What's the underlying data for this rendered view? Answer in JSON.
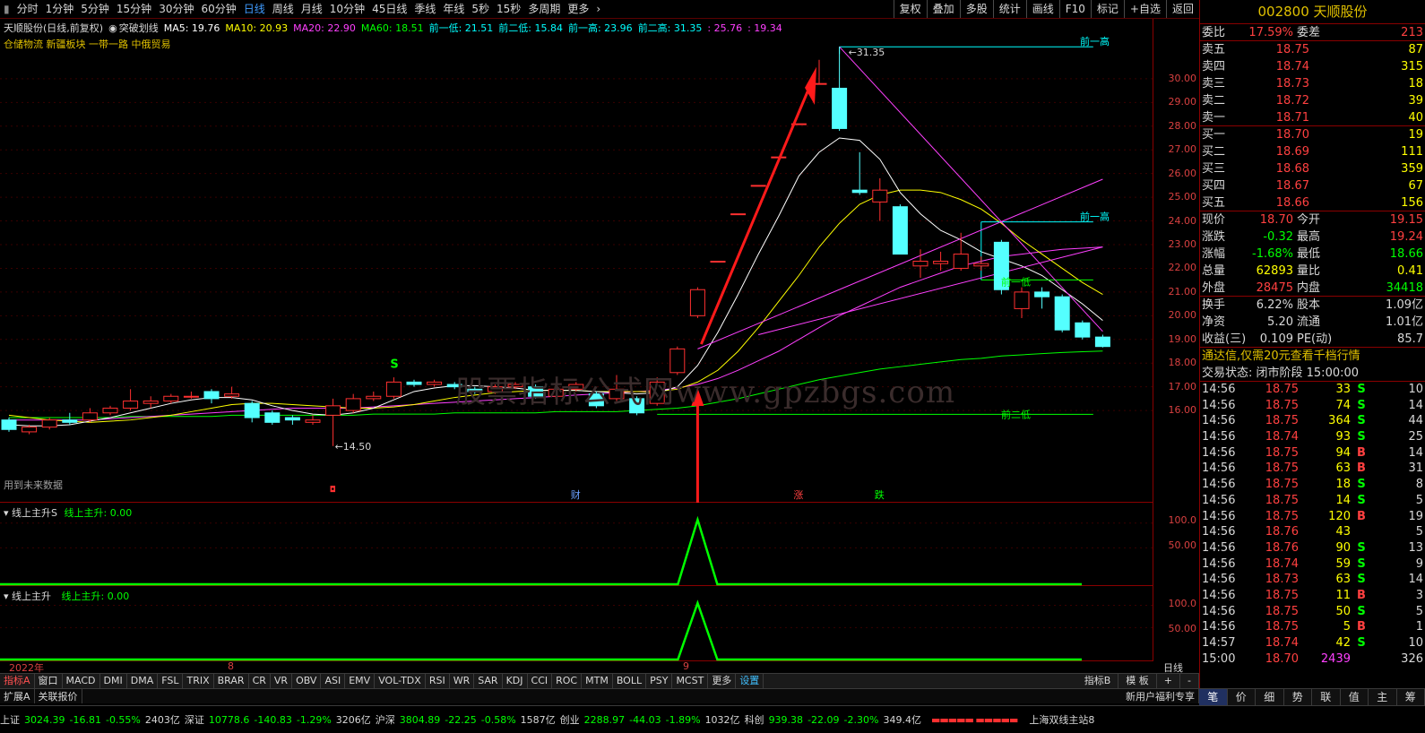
{
  "toolbar": {
    "periods": [
      "分时",
      "1分钟",
      "5分钟",
      "15分钟",
      "30分钟",
      "60分钟",
      "日线",
      "周线",
      "月线",
      "10分钟",
      "45日线",
      "季线",
      "年线",
      "5秒",
      "15秒",
      "多周期",
      "更多"
    ],
    "active_period": "日线",
    "right_buttons": [
      "复权",
      "叠加",
      "多股",
      "统计",
      "画线",
      "F10",
      "标记",
      "+自选",
      "返回"
    ]
  },
  "chart_title": {
    "name": "天顺股份(日线,前复权)",
    "indicator": "突破划线",
    "items": [
      {
        "label": "MA5: 19.76",
        "color": "#ffffff"
      },
      {
        "label": "MA10: 20.93",
        "color": "#ffff00"
      },
      {
        "label": "MA20: 22.90",
        "color": "#ff40ff"
      },
      {
        "label": "MA60: 18.51",
        "color": "#00ff00"
      },
      {
        "label": "前一低: 21.51",
        "color": "#00ffff"
      },
      {
        "label": "前二低: 15.84",
        "color": "#00ffff"
      },
      {
        "label": "前一高: 23.96",
        "color": "#00ffff"
      },
      {
        "label": "前二高: 31.35",
        "color": "#00ffff"
      },
      {
        "label": ": 25.76",
        "color": "#ff40ff"
      },
      {
        "label": ": 19.34",
        "color": "#ff40ff"
      }
    ],
    "sectors": "仓储物流 新疆板块 一带一路 中俄贸易",
    "future_warning": "用到未来数据"
  },
  "watermark": "股票指标公式网www.gpzbgs.com",
  "annotations": {
    "high_label": "31.35",
    "low_label": "14.50",
    "prev_high1": "前一高",
    "prev_high2": "前一高",
    "prev_low1": "前一低",
    "prev_low2": "前二低",
    "signal_s": "S",
    "markers": [
      "财",
      "涨",
      "跌"
    ]
  },
  "chart_data": {
    "type": "candlestick",
    "ylim": [
      14,
      32
    ],
    "y_ticks": [
      "30.00",
      "29.00",
      "28.00",
      "27.00",
      "26.00",
      "25.00",
      "24.00",
      "23.00",
      "22.00",
      "21.00",
      "20.00",
      "19.00",
      "18.00",
      "17.00",
      "16.00"
    ],
    "dates_axis": [
      "2022年",
      "8",
      "9"
    ],
    "candles": [
      {
        "o": 15.6,
        "c": 15.2,
        "h": 15.7,
        "l": 15.1
      },
      {
        "o": 15.1,
        "c": 15.3,
        "h": 15.4,
        "l": 15.0
      },
      {
        "o": 15.3,
        "c": 15.6,
        "h": 15.7,
        "l": 15.2
      },
      {
        "o": 15.6,
        "c": 15.5,
        "h": 15.9,
        "l": 15.4
      },
      {
        "o": 15.6,
        "c": 15.9,
        "h": 16.1,
        "l": 15.5
      },
      {
        "o": 15.9,
        "c": 16.1,
        "h": 16.2,
        "l": 15.8
      },
      {
        "o": 16.1,
        "c": 16.4,
        "h": 16.9,
        "l": 16.0
      },
      {
        "o": 16.3,
        "c": 16.4,
        "h": 16.6,
        "l": 16.1
      },
      {
        "o": 16.4,
        "c": 16.6,
        "h": 16.7,
        "l": 16.3
      },
      {
        "o": 16.6,
        "c": 16.6,
        "h": 16.8,
        "l": 16.5
      },
      {
        "o": 16.8,
        "c": 16.5,
        "h": 16.9,
        "l": 16.3
      },
      {
        "o": 16.6,
        "c": 16.7,
        "h": 17.0,
        "l": 16.5
      },
      {
        "o": 16.3,
        "c": 15.7,
        "h": 16.4,
        "l": 15.5
      },
      {
        "o": 15.9,
        "c": 15.5,
        "h": 16.0,
        "l": 15.4
      },
      {
        "o": 15.7,
        "c": 15.6,
        "h": 15.8,
        "l": 15.4
      },
      {
        "o": 15.5,
        "c": 15.6,
        "h": 15.8,
        "l": 15.4
      },
      {
        "o": 15.8,
        "c": 16.2,
        "h": 16.5,
        "l": 14.5
      },
      {
        "o": 16.0,
        "c": 16.5,
        "h": 16.7,
        "l": 15.9
      },
      {
        "o": 16.5,
        "c": 16.6,
        "h": 16.8,
        "l": 16.4
      },
      {
        "o": 16.6,
        "c": 17.2,
        "h": 17.4,
        "l": 16.5
      },
      {
        "o": 17.2,
        "c": 17.1,
        "h": 17.3,
        "l": 17.0
      },
      {
        "o": 17.1,
        "c": 17.2,
        "h": 17.3,
        "l": 17.0
      },
      {
        "o": 17.1,
        "c": 17.0,
        "h": 17.2,
        "l": 16.9
      },
      {
        "o": 16.9,
        "c": 16.8,
        "h": 17.0,
        "l": 16.7
      },
      {
        "o": 16.8,
        "c": 17.0,
        "h": 17.1,
        "l": 16.7
      },
      {
        "o": 17.0,
        "c": 17.1,
        "h": 17.2,
        "l": 16.9
      },
      {
        "o": 17.0,
        "c": 16.6,
        "h": 17.1,
        "l": 16.5
      },
      {
        "o": 16.6,
        "c": 16.9,
        "h": 17.0,
        "l": 16.5
      },
      {
        "o": 16.9,
        "c": 17.1,
        "h": 17.2,
        "l": 16.8
      },
      {
        "o": 16.7,
        "c": 16.2,
        "h": 16.8,
        "l": 16.1
      },
      {
        "o": 16.5,
        "c": 16.9,
        "h": 17.5,
        "l": 16.4
      },
      {
        "o": 16.5,
        "c": 15.9,
        "h": 16.6,
        "l": 15.8
      },
      {
        "o": 16.3,
        "c": 17.2,
        "h": 17.4,
        "l": 16.2
      },
      {
        "o": 17.6,
        "c": 18.6,
        "h": 18.7,
        "l": 17.5
      },
      {
        "o": 20.0,
        "c": 21.1,
        "h": 21.2,
        "l": 19.9
      },
      {
        "o": 22.3,
        "c": 22.3,
        "h": 22.3,
        "l": 22.3
      },
      {
        "o": 24.3,
        "c": 24.3,
        "h": 24.3,
        "l": 24.3
      },
      {
        "o": 25.5,
        "c": 25.5,
        "h": 25.5,
        "l": 25.5
      },
      {
        "o": 26.7,
        "c": 26.7,
        "h": 26.7,
        "l": 26.7
      },
      {
        "o": 28.1,
        "c": 28.1,
        "h": 28.1,
        "l": 28.1
      },
      {
        "o": 29.8,
        "c": 29.8,
        "h": 30.8,
        "l": 29.8
      },
      {
        "o": 29.6,
        "c": 27.9,
        "h": 31.35,
        "l": 27.8
      },
      {
        "o": 25.3,
        "c": 25.2,
        "h": 26.9,
        "l": 25.1
      },
      {
        "o": 24.8,
        "c": 25.3,
        "h": 25.8,
        "l": 24.0
      },
      {
        "o": 24.6,
        "c": 22.6,
        "h": 24.7,
        "l": 22.6
      },
      {
        "o": 22.1,
        "c": 22.3,
        "h": 22.8,
        "l": 21.6
      },
      {
        "o": 22.2,
        "c": 22.3,
        "h": 22.7,
        "l": 21.9
      },
      {
        "o": 22.0,
        "c": 22.6,
        "h": 23.5,
        "l": 21.9
      },
      {
        "o": 22.1,
        "c": 22.2,
        "h": 22.5,
        "l": 21.9
      },
      {
        "o": 23.1,
        "c": 21.1,
        "h": 23.2,
        "l": 20.9
      },
      {
        "o": 20.3,
        "c": 21.0,
        "h": 21.2,
        "l": 19.9
      },
      {
        "o": 21.0,
        "c": 20.8,
        "h": 21.2,
        "l": 20.3
      },
      {
        "o": 20.8,
        "c": 19.4,
        "h": 20.9,
        "l": 19.3
      },
      {
        "o": 19.7,
        "c": 19.1,
        "h": 19.8,
        "l": 19.0
      },
      {
        "o": 19.1,
        "c": 18.7,
        "h": 19.2,
        "l": 18.66
      }
    ],
    "ma5": [
      15.4,
      15.35,
      15.35,
      15.4,
      15.55,
      15.7,
      15.9,
      16.1,
      16.3,
      16.45,
      16.55,
      16.55,
      16.45,
      16.2,
      16.0,
      15.85,
      15.8,
      15.9,
      16.1,
      16.45,
      16.8,
      16.95,
      17.05,
      17.05,
      17.0,
      16.95,
      16.85,
      16.85,
      16.85,
      16.8,
      16.75,
      16.7,
      16.75,
      17.0,
      17.9,
      19.3,
      20.9,
      22.6,
      24.2,
      25.9,
      26.9,
      27.5,
      27.4,
      26.6,
      25.2,
      24.3,
      23.6,
      23.2,
      22.7,
      22.4,
      22.1,
      21.7,
      21.1,
      20.5,
      19.8
    ],
    "ma10": [
      15.8,
      15.7,
      15.6,
      15.55,
      15.5,
      15.55,
      15.6,
      15.7,
      15.8,
      15.95,
      16.1,
      16.25,
      16.3,
      16.3,
      16.25,
      16.2,
      16.15,
      16.1,
      16.1,
      16.15,
      16.25,
      16.4,
      16.55,
      16.65,
      16.75,
      16.8,
      16.85,
      16.85,
      16.85,
      16.8,
      16.8,
      16.8,
      16.8,
      16.9,
      17.2,
      17.7,
      18.5,
      19.5,
      20.6,
      21.7,
      22.9,
      23.9,
      24.7,
      25.1,
      25.3,
      25.3,
      25.2,
      24.9,
      24.5,
      23.9,
      23.2,
      22.6,
      22.0,
      21.4,
      20.9
    ],
    "ma20": [
      15.6,
      15.6,
      15.6,
      15.6,
      15.6,
      15.65,
      15.7,
      15.75,
      15.8,
      15.85,
      15.9,
      15.95,
      16.0,
      16.05,
      16.1,
      16.1,
      16.1,
      16.1,
      16.15,
      16.2,
      16.25,
      16.3,
      16.35,
      16.4,
      16.45,
      16.5,
      16.55,
      16.6,
      16.65,
      16.7,
      16.75,
      16.8,
      16.85,
      16.95,
      17.1,
      17.35,
      17.7,
      18.1,
      18.5,
      19.0,
      19.5,
      20.0,
      20.4,
      20.8,
      21.2,
      21.5,
      21.8,
      22.1,
      22.3,
      22.5,
      22.6,
      22.7,
      22.8,
      22.85,
      22.9
    ],
    "ma60": [
      15.7,
      15.7,
      15.7,
      15.7,
      15.7,
      15.7,
      15.75,
      15.75,
      15.75,
      15.75,
      15.75,
      15.8,
      15.8,
      15.8,
      15.8,
      15.8,
      15.8,
      15.8,
      15.85,
      15.85,
      15.85,
      15.85,
      15.9,
      15.9,
      15.9,
      15.9,
      15.9,
      15.95,
      15.95,
      15.95,
      15.95,
      16.0,
      16.05,
      16.1,
      16.2,
      16.35,
      16.5,
      16.7,
      16.9,
      17.1,
      17.3,
      17.45,
      17.6,
      17.75,
      17.85,
      17.95,
      18.05,
      18.15,
      18.2,
      18.3,
      18.35,
      18.4,
      18.45,
      18.48,
      18.51
    ],
    "levels": {
      "prev_high2": 31.35,
      "prev_high1": 23.96,
      "prev_low1": 21.51,
      "prev_low2": 15.84
    },
    "trend_line_up": {
      "from_index": 34,
      "to_index": 54,
      "from": 18.6,
      "to": 25.76
    },
    "trend_line_down": {
      "from_index": 41,
      "to_index": 54,
      "from": 31.35,
      "to": 19.34
    },
    "trend_line_mid": {
      "from_index": 37,
      "to_index": 54,
      "from": 19.2,
      "to": 22.9
    },
    "signal_index": 34,
    "sub_ticks": [
      "100.0",
      "50.00"
    ]
  },
  "sub1": {
    "title": "线上主升S",
    "value_label": "线上主升: 0.00"
  },
  "sub2": {
    "title": "线上主升",
    "value_label": "线上主升: 0.00"
  },
  "period_label": "日线",
  "indicator_tabs": [
    "指标A",
    "窗口",
    "MACD",
    "DMI",
    "DMA",
    "FSL",
    "TRIX",
    "BRAR",
    "CR",
    "VR",
    "OBV",
    "ASI",
    "EMV",
    "VOL-TDX",
    "RSI",
    "WR",
    "SAR",
    "KDJ",
    "CCI",
    "ROC",
    "MTM",
    "BOLL",
    "PSY",
    "MCST",
    "更多",
    "设置"
  ],
  "indicator_right": [
    "指标B",
    "模 板",
    "+",
    "-"
  ],
  "expand_bar": [
    "扩展A",
    "关联报价"
  ],
  "newuser": "新用户福利专享",
  "right_tabs": [
    "笔",
    "价",
    "细",
    "势",
    "联",
    "值",
    "主",
    "筹"
  ],
  "quote": {
    "code_name": "002800 天顺股份",
    "weibi_label": "委比",
    "weibi": "17.59%",
    "weicha_label": "委差",
    "weicha": "213",
    "sell": [
      {
        "label": "卖五",
        "price": "18.75",
        "vol": "87"
      },
      {
        "label": "卖四",
        "price": "18.74",
        "vol": "315"
      },
      {
        "label": "卖三",
        "price": "18.73",
        "vol": "18"
      },
      {
        "label": "卖二",
        "price": "18.72",
        "vol": "39"
      },
      {
        "label": "卖一",
        "price": "18.71",
        "vol": "40"
      }
    ],
    "buy": [
      {
        "label": "买一",
        "price": "18.70",
        "vol": "19"
      },
      {
        "label": "买二",
        "price": "18.69",
        "vol": "111"
      },
      {
        "label": "买三",
        "price": "18.68",
        "vol": "359"
      },
      {
        "label": "买四",
        "price": "18.67",
        "vol": "67"
      },
      {
        "label": "买五",
        "price": "18.66",
        "vol": "156"
      }
    ],
    "stats": [
      {
        "l1": "现价",
        "v1": "18.70",
        "c1": "#ff4040",
        "l2": "今开",
        "v2": "19.15",
        "c2": "#ff4040"
      },
      {
        "l1": "涨跌",
        "v1": "-0.32",
        "c1": "#00ff00",
        "l2": "最高",
        "v2": "19.24",
        "c2": "#ff4040"
      },
      {
        "l1": "涨幅",
        "v1": "-1.68%",
        "c1": "#00ff00",
        "l2": "最低",
        "v2": "18.66",
        "c2": "#00ff00"
      },
      {
        "l1": "总量",
        "v1": "62893",
        "c1": "#ffff00",
        "l2": "量比",
        "v2": "0.41",
        "c2": "#ffff00"
      },
      {
        "l1": "外盘",
        "v1": "28475",
        "c1": "#ff4040",
        "l2": "内盘",
        "v2": "34418",
        "c2": "#00ff00"
      }
    ],
    "stats2": [
      {
        "l1": "换手",
        "v1": "6.22%",
        "l2": "股本",
        "v2": "1.09亿"
      },
      {
        "l1": "净资",
        "v1": "5.20",
        "l2": "流通",
        "v2": "1.01亿"
      },
      {
        "l1": "收益(三)",
        "v1": "0.109",
        "l2": "PE(动)",
        "v2": "85.7"
      }
    ],
    "ad": "通达信,仅需20元查看千档行情",
    "trade_state": "交易状态: 闭市阶段 15:00:00",
    "ticks": [
      {
        "t": "14:56",
        "p": "18.75",
        "v": "33",
        "d": "S",
        "n": "10"
      },
      {
        "t": "14:56",
        "p": "18.75",
        "v": "74",
        "d": "S",
        "n": "14"
      },
      {
        "t": "14:56",
        "p": "18.75",
        "v": "364",
        "d": "S",
        "n": "44"
      },
      {
        "t": "14:56",
        "p": "18.74",
        "v": "93",
        "d": "S",
        "n": "25"
      },
      {
        "t": "14:56",
        "p": "18.75",
        "v": "94",
        "d": "B",
        "n": "14"
      },
      {
        "t": "14:56",
        "p": "18.75",
        "v": "63",
        "d": "B",
        "n": "31"
      },
      {
        "t": "14:56",
        "p": "18.75",
        "v": "18",
        "d": "S",
        "n": "8"
      },
      {
        "t": "14:56",
        "p": "18.75",
        "v": "14",
        "d": "S",
        "n": "5"
      },
      {
        "t": "14:56",
        "p": "18.75",
        "v": "120",
        "d": "B",
        "n": "19"
      },
      {
        "t": "14:56",
        "p": "18.76",
        "v": "43",
        "d": "",
        "n": "5"
      },
      {
        "t": "14:56",
        "p": "18.76",
        "v": "90",
        "d": "S",
        "n": "13"
      },
      {
        "t": "14:56",
        "p": "18.74",
        "v": "59",
        "d": "S",
        "n": "9"
      },
      {
        "t": "14:56",
        "p": "18.73",
        "v": "63",
        "d": "S",
        "n": "14"
      },
      {
        "t": "14:56",
        "p": "18.75",
        "v": "11",
        "d": "B",
        "n": "3"
      },
      {
        "t": "14:56",
        "p": "18.75",
        "v": "50",
        "d": "S",
        "n": "5"
      },
      {
        "t": "14:56",
        "p": "18.75",
        "v": "5",
        "d": "B",
        "n": "1"
      },
      {
        "t": "14:57",
        "p": "18.74",
        "v": "42",
        "d": "S",
        "n": "10"
      },
      {
        "t": "15:00",
        "p": "18.70",
        "v": "2439",
        "d": "",
        "n": "326"
      }
    ]
  },
  "status": [
    {
      "text": "上证",
      "color": "#d8d8d8"
    },
    {
      "text": "3024.39",
      "color": "#00ff00"
    },
    {
      "text": "-16.81",
      "color": "#00ff00"
    },
    {
      "text": "-0.55%",
      "color": "#00ff00"
    },
    {
      "text": "2403亿",
      "color": "#d8d8d8"
    },
    {
      "text": "深证",
      "color": "#d8d8d8"
    },
    {
      "text": "10778.6",
      "color": "#00ff00"
    },
    {
      "text": "-140.83",
      "color": "#00ff00"
    },
    {
      "text": "-1.29%",
      "color": "#00ff00"
    },
    {
      "text": "3206亿",
      "color": "#d8d8d8"
    },
    {
      "text": "沪深",
      "color": "#d8d8d8"
    },
    {
      "text": "3804.89",
      "color": "#00ff00"
    },
    {
      "text": "-22.25",
      "color": "#00ff00"
    },
    {
      "text": "-0.58%",
      "color": "#00ff00"
    },
    {
      "text": "1587亿",
      "color": "#d8d8d8"
    },
    {
      "text": "创业",
      "color": "#d8d8d8"
    },
    {
      "text": "2288.97",
      "color": "#00ff00"
    },
    {
      "text": "-44.03",
      "color": "#00ff00"
    },
    {
      "text": "-1.89%",
      "color": "#00ff00"
    },
    {
      "text": "1032亿",
      "color": "#d8d8d8"
    },
    {
      "text": "科创",
      "color": "#d8d8d8"
    },
    {
      "text": "939.38",
      "color": "#00ff00"
    },
    {
      "text": "-22.09",
      "color": "#00ff00"
    },
    {
      "text": "-2.30%",
      "color": "#00ff00"
    },
    {
      "text": "349.4亿",
      "color": "#d8d8d8"
    }
  ],
  "server": "上海双线主站8"
}
